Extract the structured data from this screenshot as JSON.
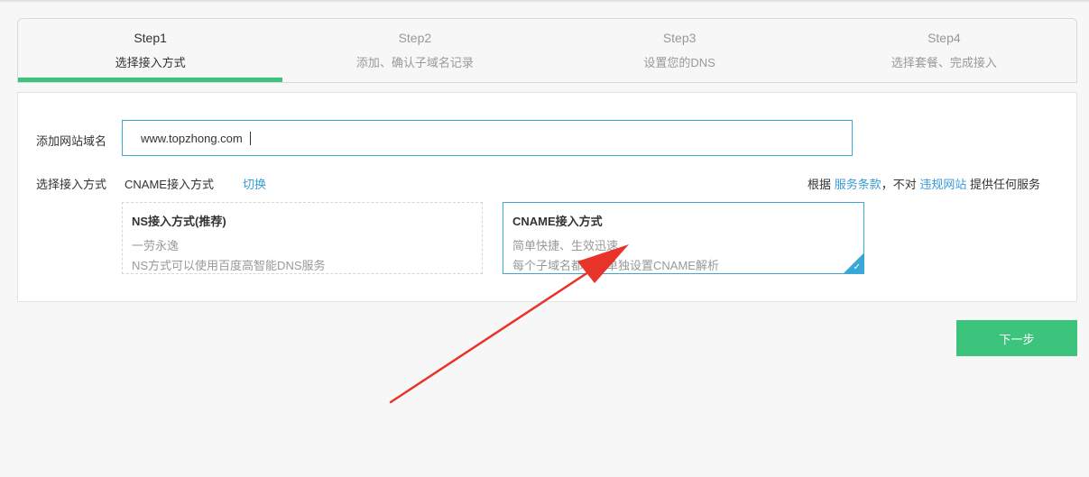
{
  "steps": [
    {
      "num": "Step1",
      "label": "选择接入方式",
      "active": true
    },
    {
      "num": "Step2",
      "label": "添加、确认子域名记录",
      "active": false
    },
    {
      "num": "Step3",
      "label": "设置您的DNS",
      "active": false
    },
    {
      "num": "Step4",
      "label": "选择套餐、完成接入",
      "active": false
    }
  ],
  "form": {
    "domain_label": "添加网站域名",
    "domain_value": "www.topzhong.com",
    "method_label": "选择接入方式",
    "method_value": "CNAME接入方式",
    "switch_label": "切换"
  },
  "terms": {
    "prefix": "根据",
    "service_link": "服务条款",
    "middle": "，不对",
    "violation_link": "违规网站",
    "suffix": "提供任何服务"
  },
  "cards": {
    "ns": {
      "title": "NS接入方式(推荐)",
      "line1": "一劳永逸",
      "line2": "NS方式可以使用百度高智能DNS服务"
    },
    "cname": {
      "title": "CNAME接入方式",
      "line1": "简单快捷、生效迅速",
      "line2": "每个子域名都需要单独设置CNAME解析",
      "selected": true
    }
  },
  "next_button": "下一步",
  "colors": {
    "accent_green": "#3cc47c",
    "link_blue": "#3a9bd9",
    "annotation_red": "#e8332a"
  },
  "icons": {
    "selected_check": "checkmark-icon",
    "annotation": "red-arrow-icon"
  }
}
